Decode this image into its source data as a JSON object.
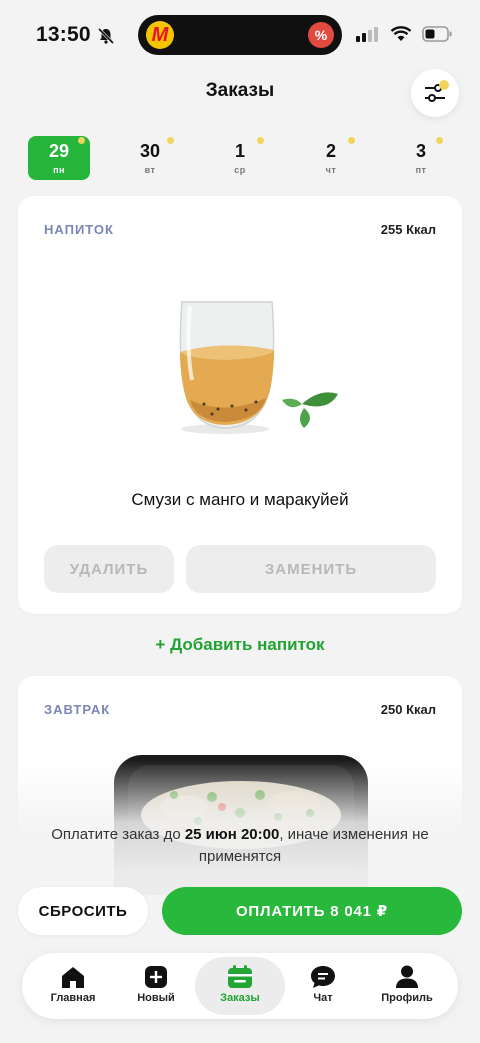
{
  "status_bar": {
    "time": "13:50",
    "island_app_letter": "M",
    "island_badge": "%"
  },
  "header": {
    "title": "Заказы",
    "filter_icon": "sliders-icon",
    "filter_dot_color": "#f2d45c"
  },
  "days": [
    {
      "num": "29",
      "wd": "пн",
      "active": true
    },
    {
      "num": "30",
      "wd": "вт",
      "active": false
    },
    {
      "num": "1",
      "wd": "ср",
      "active": false
    },
    {
      "num": "2",
      "wd": "чт",
      "active": false
    },
    {
      "num": "3",
      "wd": "пт",
      "active": false
    }
  ],
  "drink_card": {
    "category": "НАПИТОК",
    "kcal": "255 Ккал",
    "dish": "Смузи с манго и маракуйей",
    "delete_label": "УДАЛИТЬ",
    "replace_label": "ЗАМЕНИТЬ"
  },
  "add_drink": {
    "label": "+ Добавить напиток"
  },
  "breakfast_card": {
    "category": "ЗАВТРАК",
    "kcal": "250 Ккал"
  },
  "notice": {
    "before": "Оплатите заказ до ",
    "deadline": "25 июн 20:00",
    "after": ", иначе изменения не применятся"
  },
  "actions": {
    "reset_label": "СБРОСИТЬ",
    "pay_label": "ОПЛАТИТЬ 8 041 ₽"
  },
  "tabbar": {
    "items": [
      {
        "label": "Главная",
        "icon": "home-icon"
      },
      {
        "label": "Новый",
        "icon": "plus-icon"
      },
      {
        "label": "Заказы",
        "icon": "calendar-icon",
        "active": true
      },
      {
        "label": "Чат",
        "icon": "chat-icon"
      },
      {
        "label": "Профиль",
        "icon": "profile-icon"
      }
    ]
  },
  "colors": {
    "accent_green": "#27b83c",
    "category_blue": "#7a86b5",
    "dot_yellow": "#f2d45c"
  }
}
